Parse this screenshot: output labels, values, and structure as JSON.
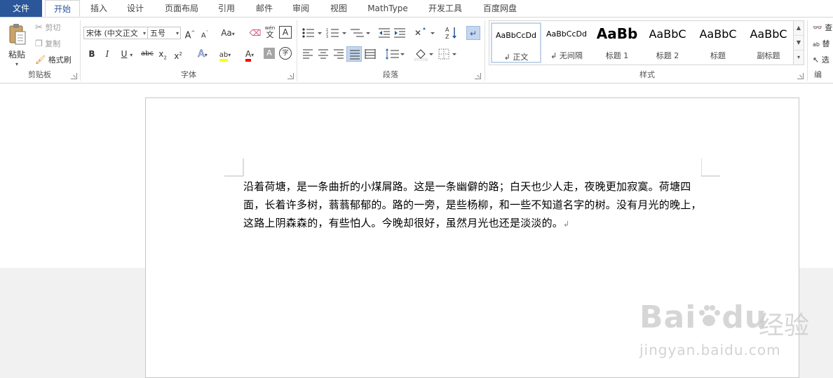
{
  "tabs": [
    {
      "label": "文件"
    },
    {
      "label": "开始"
    },
    {
      "label": "插入"
    },
    {
      "label": "设计"
    },
    {
      "label": "页面布局"
    },
    {
      "label": "引用"
    },
    {
      "label": "邮件"
    },
    {
      "label": "审阅"
    },
    {
      "label": "视图"
    },
    {
      "label": "MathType"
    },
    {
      "label": "开发工具"
    },
    {
      "label": "百度网盘"
    }
  ],
  "clipboard": {
    "paste": "粘贴",
    "cut": "剪切",
    "copy": "复制",
    "format_painter": "格式刷",
    "group_label": "剪贴板"
  },
  "font": {
    "font_name": "宋体 (中文正文",
    "font_size": "五号",
    "grow": "A",
    "shrink": "A",
    "case": "Aa",
    "phonetic_top": "wén",
    "phonetic_bottom": "文",
    "bold": "B",
    "italic": "I",
    "underline": "U",
    "strike": "abc",
    "subscript": "x",
    "superscript": "x",
    "text_effects": "A",
    "highlight": "ab",
    "font_color": "A",
    "char_shading": "A",
    "enclose": "字",
    "group_label": "字体"
  },
  "paragraph": {
    "group_label": "段落"
  },
  "styles": {
    "items": [
      {
        "sample": "AaBbCcDd",
        "name": "↲ 正文"
      },
      {
        "sample": "AaBbCcDd",
        "name": "↲ 无间隔"
      },
      {
        "sample": "AaBb",
        "name": "标题 1"
      },
      {
        "sample": "AaBbC",
        "name": "标题 2"
      },
      {
        "sample": "AaBbC",
        "name": "标题"
      },
      {
        "sample": "AaBbC",
        "name": "副标题"
      }
    ],
    "group_label": "样式"
  },
  "editing": {
    "find": "查",
    "replace": "替",
    "select": "选",
    "group_label": "编"
  },
  "document": {
    "text": "沿着荷塘，是一条曲折的小煤屑路。这是一条幽僻的路；白天也少人走，夜晚更加寂寞。荷塘四面，长着许多树，蓊蓊郁郁的。路的一旁，是些杨柳，和一些不知道名字的树。没有月光的晚上，这路上阴森森的，有些怕人。今晚却很好，虽然月光也还是淡淡的。",
    "paragraph_mark": "↲"
  },
  "watermark": {
    "brand": "Bai",
    "brand2": "du",
    "cn": "经验",
    "url": "jingyan.baidu.com"
  },
  "colors": {
    "accent": "#2b579a",
    "highlight_yellow": "#ffff00",
    "font_red": "#ff0000"
  }
}
